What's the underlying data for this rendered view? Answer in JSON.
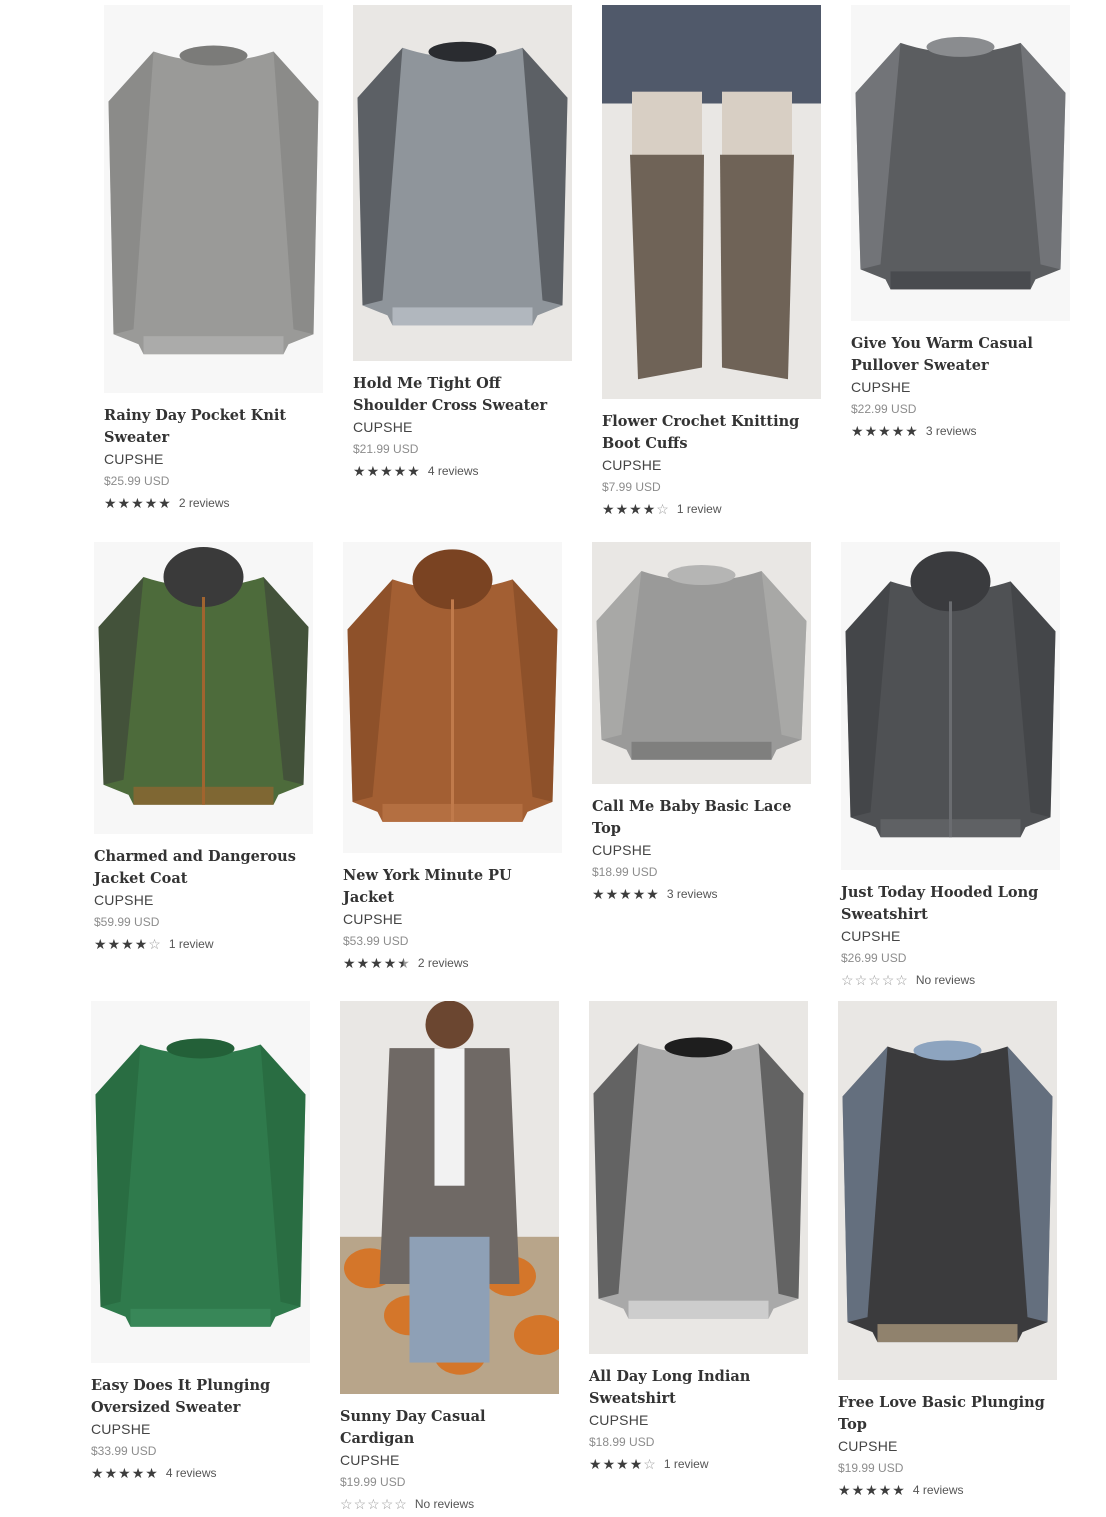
{
  "products": [
    {
      "title": "Rainy Day Pocket Knit Sweater",
      "vendor": "CUPSHE",
      "price": "$25.99 USD",
      "stars": 5,
      "reviews": "2 reviews",
      "image": "grey-knit-sweater",
      "colors": [
        "#9a9a98",
        "#7b7b79",
        "#b8b8b5"
      ]
    },
    {
      "title": "Hold Me Tight Off Shoulder Cross Sweater",
      "vendor": "CUPSHE",
      "price": "$21.99 USD",
      "stars": 5,
      "reviews": "4 reviews",
      "image": "grey-wrap-sweater",
      "colors": [
        "#8f959b",
        "#2a2c30",
        "#c8cfd6"
      ]
    },
    {
      "title": "Flower Crochet Knitting Boot Cuffs",
      "vendor": "CUPSHE",
      "price": "$7.99 USD",
      "stars": 4,
      "reviews": "1 review",
      "image": "boot-cuffs",
      "colors": [
        "#6f6357",
        "#d8cfc4",
        "#50596a"
      ]
    },
    {
      "title": "Give You Warm Casual Pullover Sweater",
      "vendor": "CUPSHE",
      "price": "$22.99 USD",
      "stars": 5,
      "reviews": "3 reviews",
      "image": "marled-sweater",
      "colors": [
        "#5b5d60",
        "#8a8c8f",
        "#3e4044"
      ]
    },
    {
      "title": "Charmed and Dangerous Jacket Coat",
      "vendor": "CUPSHE",
      "price": "$59.99 USD",
      "stars": 4,
      "reviews": "1 review",
      "image": "green-jacket",
      "colors": [
        "#4d6b3b",
        "#3a3a3a",
        "#a1642f"
      ]
    },
    {
      "title": "New York Minute PU Jacket",
      "vendor": "CUPSHE",
      "price": "$53.99 USD",
      "stars": 4.5,
      "reviews": "2 reviews",
      "image": "brown-pu-jacket",
      "colors": [
        "#a35f33",
        "#7a4322",
        "#c07a4b"
      ]
    },
    {
      "title": "Call Me Baby Basic Lace Top",
      "vendor": "CUPSHE",
      "price": "$18.99 USD",
      "stars": 5,
      "reviews": "3 reviews",
      "image": "lace-top",
      "colors": [
        "#9a9a99",
        "#b5b5b4",
        "#6e6e6d"
      ]
    },
    {
      "title": "Just Today Hooded Long Sweatshirt",
      "vendor": "CUPSHE",
      "price": "$26.99 USD",
      "stars": 0,
      "reviews": "No reviews",
      "image": "hooded-sweatshirt",
      "colors": [
        "#4f5154",
        "#3a3b3e",
        "#6a6c70"
      ]
    },
    {
      "title": "Easy Does It Plunging Oversized Sweater",
      "vendor": "CUPSHE",
      "price": "$33.99 USD",
      "stars": 5,
      "reviews": "4 reviews",
      "image": "green-sweater",
      "colors": [
        "#2f7a4c",
        "#236038",
        "#3f9060"
      ]
    },
    {
      "title": "Sunny Day Casual Cardigan",
      "vendor": "CUPSHE",
      "price": "$19.99 USD",
      "stars": 0,
      "reviews": "No reviews",
      "image": "cardigan",
      "colors": [
        "#6f6965",
        "#d4762a",
        "#8ea0b6"
      ]
    },
    {
      "title": "All Day Long Indian Sweatshirt",
      "vendor": "CUPSHE",
      "price": "$18.99 USD",
      "stars": 4,
      "reviews": "1 review",
      "image": "indian-sweatshirt",
      "colors": [
        "#a9a9a9",
        "#1e1e1e",
        "#e6e6e6"
      ]
    },
    {
      "title": "Free Love Basic Plunging Top",
      "vendor": "CUPSHE",
      "price": "$19.99 USD",
      "stars": 5,
      "reviews": "4 reviews",
      "image": "dark-plunging-top",
      "colors": [
        "#3b3b3d",
        "#8da4bf",
        "#c9b38d"
      ]
    }
  ]
}
